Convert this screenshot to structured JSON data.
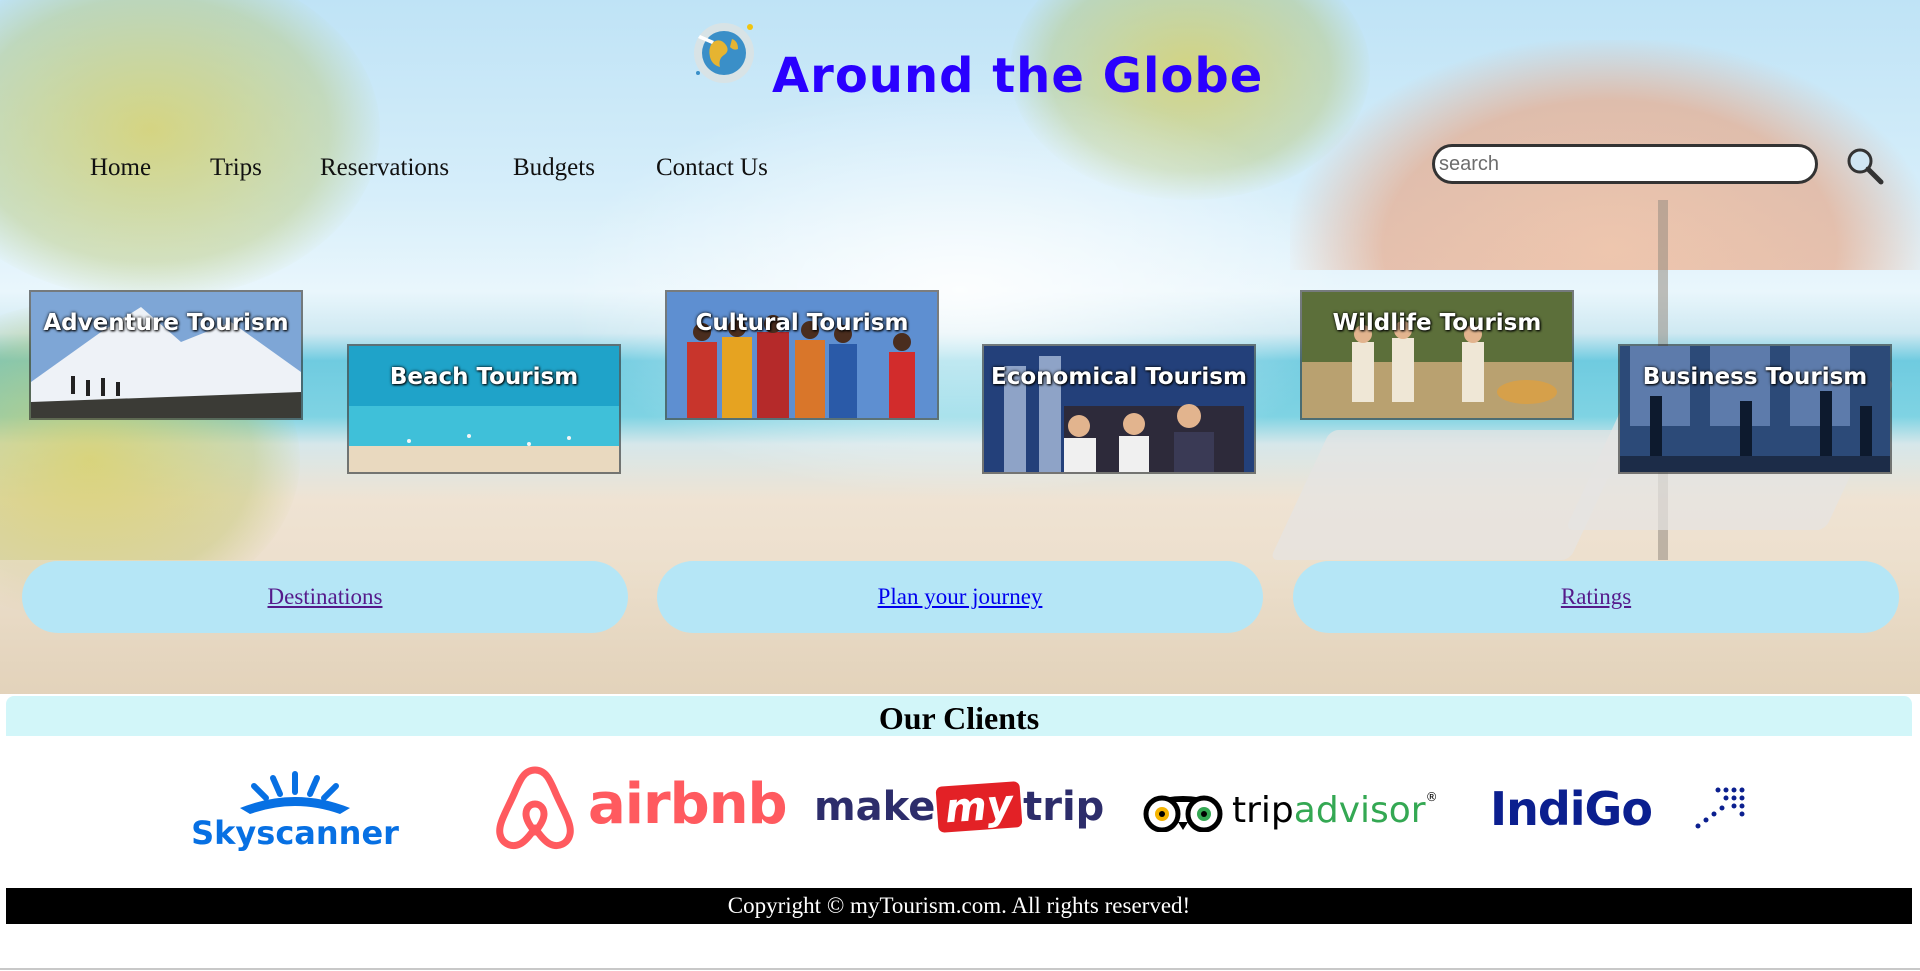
{
  "site": {
    "title": "Around the Globe"
  },
  "nav": {
    "items": [
      "Home",
      "Trips",
      "Reservations",
      "Budgets",
      "Contact Us"
    ]
  },
  "search": {
    "placeholder": "search",
    "value": ""
  },
  "categories": [
    {
      "label": "Adventure Tourism"
    },
    {
      "label": "Beach Tourism"
    },
    {
      "label": "Cultural Tourism"
    },
    {
      "label": "Economical Tourism"
    },
    {
      "label": "Wildlife Tourism"
    },
    {
      "label": "Business Tourism"
    }
  ],
  "links": [
    {
      "label": "Destinations",
      "color": "#551a8b"
    },
    {
      "label": "Plan your journey",
      "color": "#0000ee"
    },
    {
      "label": "Ratings",
      "color": "#551a8b"
    }
  ],
  "clients": {
    "heading": "Our Clients",
    "brands": [
      {
        "name": "Skyscanner",
        "color": "#0770e3"
      },
      {
        "name": "airbnb",
        "color": "#ff5a5f"
      },
      {
        "name_left": "make",
        "name_mid": "my",
        "name_right": "trip",
        "color": "#2d2d6b",
        "accent": "#e32126"
      },
      {
        "name_left": "trip",
        "name_right": "advisor",
        "mark": "®",
        "color": "#000000",
        "accent": "#34a853"
      },
      {
        "name": "IndiGo",
        "color": "#0b1f8f"
      }
    ]
  },
  "footer": {
    "text": "Copyright © myTourism.com. All rights reserved!"
  }
}
